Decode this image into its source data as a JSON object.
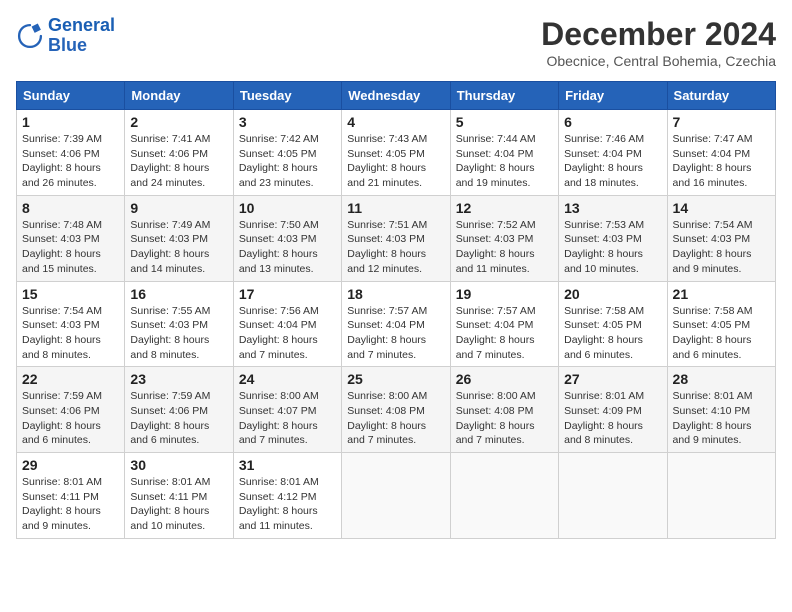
{
  "logo": {
    "line1": "General",
    "line2": "Blue"
  },
  "title": "December 2024",
  "subtitle": "Obecnice, Central Bohemia, Czechia",
  "days_of_week": [
    "Sunday",
    "Monday",
    "Tuesday",
    "Wednesday",
    "Thursday",
    "Friday",
    "Saturday"
  ],
  "weeks": [
    [
      {
        "day": "1",
        "info": "Sunrise: 7:39 AM\nSunset: 4:06 PM\nDaylight: 8 hours\nand 26 minutes."
      },
      {
        "day": "2",
        "info": "Sunrise: 7:41 AM\nSunset: 4:06 PM\nDaylight: 8 hours\nand 24 minutes."
      },
      {
        "day": "3",
        "info": "Sunrise: 7:42 AM\nSunset: 4:05 PM\nDaylight: 8 hours\nand 23 minutes."
      },
      {
        "day": "4",
        "info": "Sunrise: 7:43 AM\nSunset: 4:05 PM\nDaylight: 8 hours\nand 21 minutes."
      },
      {
        "day": "5",
        "info": "Sunrise: 7:44 AM\nSunset: 4:04 PM\nDaylight: 8 hours\nand 19 minutes."
      },
      {
        "day": "6",
        "info": "Sunrise: 7:46 AM\nSunset: 4:04 PM\nDaylight: 8 hours\nand 18 minutes."
      },
      {
        "day": "7",
        "info": "Sunrise: 7:47 AM\nSunset: 4:04 PM\nDaylight: 8 hours\nand 16 minutes."
      }
    ],
    [
      {
        "day": "8",
        "info": "Sunrise: 7:48 AM\nSunset: 4:03 PM\nDaylight: 8 hours\nand 15 minutes."
      },
      {
        "day": "9",
        "info": "Sunrise: 7:49 AM\nSunset: 4:03 PM\nDaylight: 8 hours\nand 14 minutes."
      },
      {
        "day": "10",
        "info": "Sunrise: 7:50 AM\nSunset: 4:03 PM\nDaylight: 8 hours\nand 13 minutes."
      },
      {
        "day": "11",
        "info": "Sunrise: 7:51 AM\nSunset: 4:03 PM\nDaylight: 8 hours\nand 12 minutes."
      },
      {
        "day": "12",
        "info": "Sunrise: 7:52 AM\nSunset: 4:03 PM\nDaylight: 8 hours\nand 11 minutes."
      },
      {
        "day": "13",
        "info": "Sunrise: 7:53 AM\nSunset: 4:03 PM\nDaylight: 8 hours\nand 10 minutes."
      },
      {
        "day": "14",
        "info": "Sunrise: 7:54 AM\nSunset: 4:03 PM\nDaylight: 8 hours\nand 9 minutes."
      }
    ],
    [
      {
        "day": "15",
        "info": "Sunrise: 7:54 AM\nSunset: 4:03 PM\nDaylight: 8 hours\nand 8 minutes."
      },
      {
        "day": "16",
        "info": "Sunrise: 7:55 AM\nSunset: 4:03 PM\nDaylight: 8 hours\nand 8 minutes."
      },
      {
        "day": "17",
        "info": "Sunrise: 7:56 AM\nSunset: 4:04 PM\nDaylight: 8 hours\nand 7 minutes."
      },
      {
        "day": "18",
        "info": "Sunrise: 7:57 AM\nSunset: 4:04 PM\nDaylight: 8 hours\nand 7 minutes."
      },
      {
        "day": "19",
        "info": "Sunrise: 7:57 AM\nSunset: 4:04 PM\nDaylight: 8 hours\nand 7 minutes."
      },
      {
        "day": "20",
        "info": "Sunrise: 7:58 AM\nSunset: 4:05 PM\nDaylight: 8 hours\nand 6 minutes."
      },
      {
        "day": "21",
        "info": "Sunrise: 7:58 AM\nSunset: 4:05 PM\nDaylight: 8 hours\nand 6 minutes."
      }
    ],
    [
      {
        "day": "22",
        "info": "Sunrise: 7:59 AM\nSunset: 4:06 PM\nDaylight: 8 hours\nand 6 minutes."
      },
      {
        "day": "23",
        "info": "Sunrise: 7:59 AM\nSunset: 4:06 PM\nDaylight: 8 hours\nand 6 minutes."
      },
      {
        "day": "24",
        "info": "Sunrise: 8:00 AM\nSunset: 4:07 PM\nDaylight: 8 hours\nand 7 minutes."
      },
      {
        "day": "25",
        "info": "Sunrise: 8:00 AM\nSunset: 4:08 PM\nDaylight: 8 hours\nand 7 minutes."
      },
      {
        "day": "26",
        "info": "Sunrise: 8:00 AM\nSunset: 4:08 PM\nDaylight: 8 hours\nand 7 minutes."
      },
      {
        "day": "27",
        "info": "Sunrise: 8:01 AM\nSunset: 4:09 PM\nDaylight: 8 hours\nand 8 minutes."
      },
      {
        "day": "28",
        "info": "Sunrise: 8:01 AM\nSunset: 4:10 PM\nDaylight: 8 hours\nand 9 minutes."
      }
    ],
    [
      {
        "day": "29",
        "info": "Sunrise: 8:01 AM\nSunset: 4:11 PM\nDaylight: 8 hours\nand 9 minutes."
      },
      {
        "day": "30",
        "info": "Sunrise: 8:01 AM\nSunset: 4:11 PM\nDaylight: 8 hours\nand 10 minutes."
      },
      {
        "day": "31",
        "info": "Sunrise: 8:01 AM\nSunset: 4:12 PM\nDaylight: 8 hours\nand 11 minutes."
      },
      {
        "day": "",
        "info": ""
      },
      {
        "day": "",
        "info": ""
      },
      {
        "day": "",
        "info": ""
      },
      {
        "day": "",
        "info": ""
      }
    ]
  ]
}
